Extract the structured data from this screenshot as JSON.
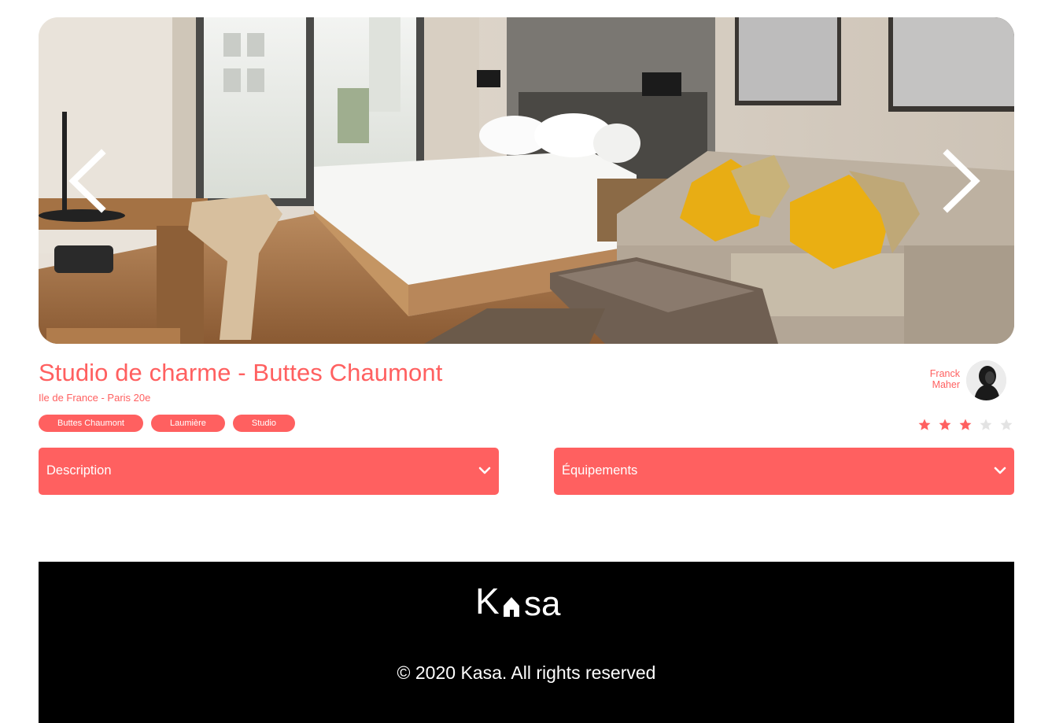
{
  "gallery": {
    "photo_alt": "Studio de charme - Buttes Chaumont",
    "prev_icon": "chevron-left-icon",
    "next_icon": "chevron-right-icon"
  },
  "listing": {
    "title": "Studio de charme - Buttes Chaumont",
    "location": "Ile de France - Paris 20e",
    "tags": [
      "Buttes Chaumont",
      "Laumière",
      "Studio"
    ]
  },
  "host": {
    "first_name": "Franck",
    "last_name": "Maher"
  },
  "rating": {
    "value": 3,
    "max": 5,
    "active_color": "#FF6060",
    "inactive_color": "#E3E3E3"
  },
  "collapses": {
    "description": "Description",
    "equipments": "Équipements"
  },
  "footer": {
    "logo_text": "Kasa",
    "copyright": "© 2020 Kasa. All rights reserved"
  },
  "colors": {
    "accent": "#FF6060",
    "footer_bg": "#000000"
  }
}
